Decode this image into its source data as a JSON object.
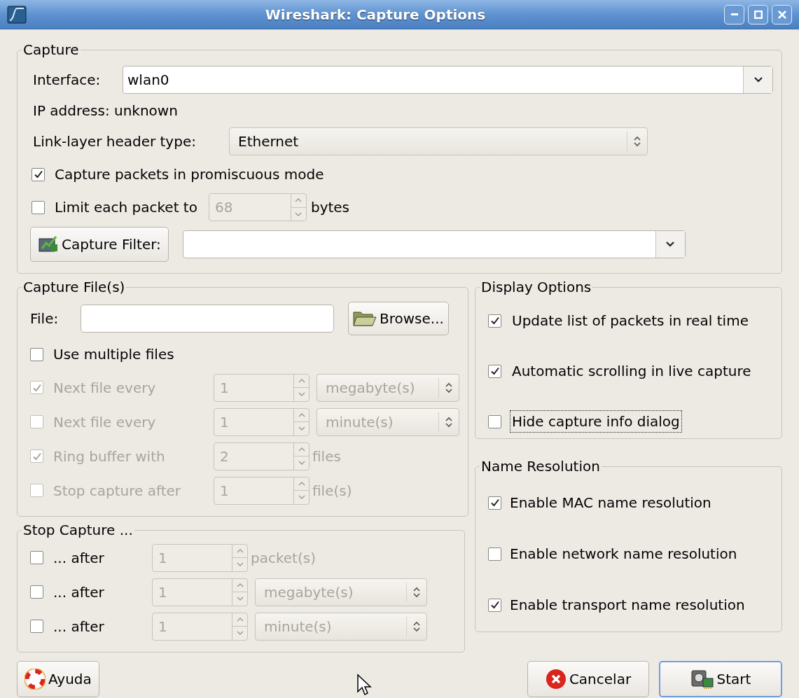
{
  "window": {
    "title": "Wireshark: Capture Options"
  },
  "capture": {
    "title": "Capture",
    "interface": {
      "label": "Interface:",
      "value": "wlan0"
    },
    "ip_address": "IP address: unknown",
    "link_layer": {
      "label": "Link-layer header type:",
      "value": "Ethernet"
    },
    "promiscuous": {
      "label": "Capture packets in promiscuous mode",
      "checked": true
    },
    "limit": {
      "label": "Limit each packet to",
      "checked": false,
      "value": "68",
      "field_disabled": true,
      "unit": "bytes"
    },
    "filter": {
      "button": "Capture Filter:"
    }
  },
  "capture_files": {
    "title": "Capture File(s)",
    "file_label": "File:",
    "browse": "Browse...",
    "multiple": {
      "label": "Use multiple files",
      "checked": false
    },
    "rows": [
      {
        "kind": "select",
        "label": "Next file every",
        "checked": true,
        "disabled": true,
        "value": "1",
        "unit": "megabyte(s)"
      },
      {
        "kind": "select",
        "label": "Next file every",
        "checked": false,
        "disabled": true,
        "value": "1",
        "unit": "minute(s)"
      },
      {
        "kind": "text",
        "label": "Ring buffer with",
        "checked": true,
        "disabled": true,
        "value": "2",
        "unit": "files"
      },
      {
        "kind": "text",
        "label": "Stop capture after",
        "checked": false,
        "disabled": true,
        "value": "1",
        "unit": "file(s)"
      }
    ]
  },
  "stop_capture": {
    "title": "Stop Capture ...",
    "rows": [
      {
        "kind": "text",
        "label": "... after",
        "checked": false,
        "disabled": false,
        "value": "1",
        "unit": "packet(s)"
      },
      {
        "kind": "select",
        "label": "... after",
        "checked": false,
        "disabled": false,
        "value": "1",
        "unit": "megabyte(s)"
      },
      {
        "kind": "select",
        "label": "... after",
        "checked": false,
        "disabled": false,
        "value": "1",
        "unit": "minute(s)"
      }
    ]
  },
  "display_options": {
    "title": "Display Options",
    "items": [
      {
        "label": "Update list of packets in real time",
        "checked": true,
        "focused": false
      },
      {
        "label": "Automatic scrolling in live capture",
        "checked": true,
        "focused": false
      },
      {
        "label": "Hide capture info dialog",
        "checked": false,
        "focused": true
      }
    ]
  },
  "name_resolution": {
    "title": "Name Resolution",
    "items": [
      {
        "label": "Enable MAC name resolution",
        "checked": true
      },
      {
        "label": "Enable network name resolution",
        "checked": false
      },
      {
        "label": "Enable transport name resolution",
        "checked": true
      }
    ]
  },
  "buttons": [
    {
      "kind": "help",
      "label": "Ayuda",
      "default": false
    },
    {
      "kind": "cancel",
      "label": "Cancelar",
      "default": false
    },
    {
      "kind": "start",
      "label": "Start",
      "default": true
    }
  ]
}
